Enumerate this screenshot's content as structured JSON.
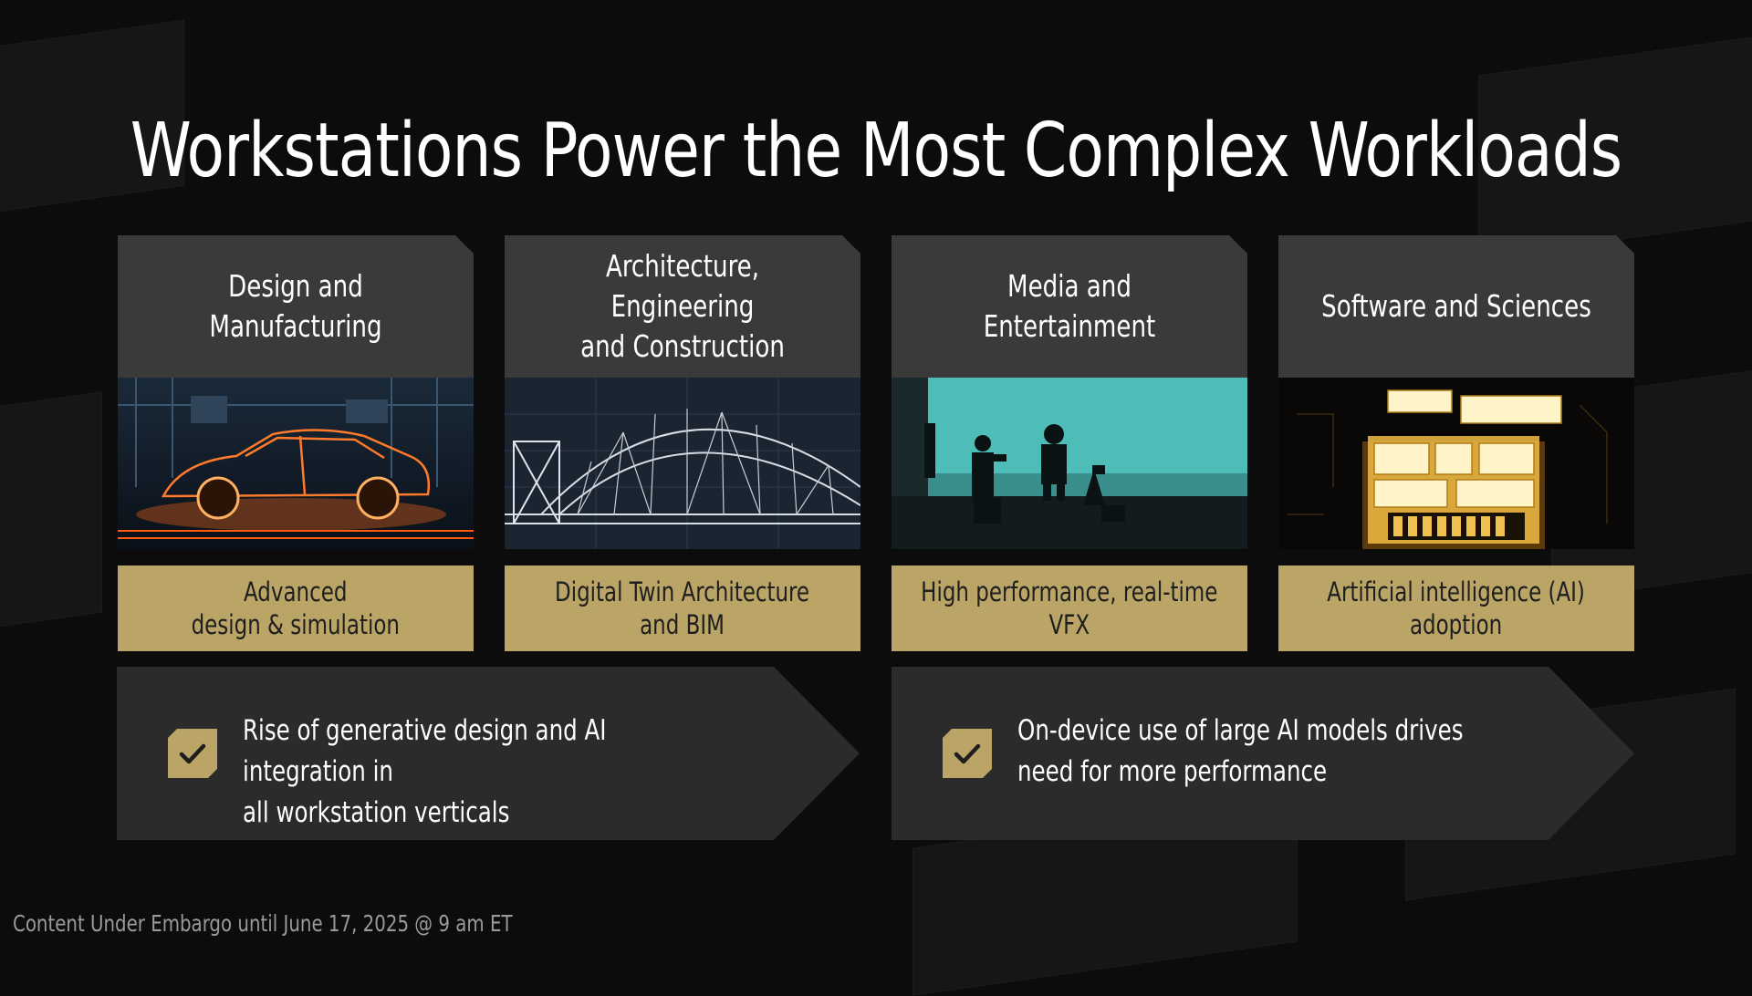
{
  "title": "Workstations Power the Most Complex Workloads",
  "cards": [
    {
      "heading": "Design and Manufacturing",
      "caption": "Advanced\ndesign & simulation",
      "image": "wireframe-car-image"
    },
    {
      "heading": "Architecture, Engineering\nand Construction",
      "caption": "Digital Twin Architecture\nand BIM",
      "image": "wireframe-bridge-image"
    },
    {
      "heading": "Media and Entertainment",
      "caption": "High performance, real-time\nVFX",
      "image": "film-set-image"
    },
    {
      "heading": "Software and Sciences",
      "caption": "Artificial intelligence (AI)\nadoption",
      "image": "glowing-chip-image"
    }
  ],
  "highlights": [
    {
      "text": "Rise of generative design and AI integration in\nall workstation verticals",
      "icon": "check-icon"
    },
    {
      "text": "On-device use of large AI models drives\nneed for more performance",
      "icon": "check-icon"
    }
  ],
  "footer": {
    "embargo": "Content Under Embargo until June 17, 2025 @ 9 am ET"
  },
  "colors": {
    "accent": "#baa566",
    "card": "#3a3a3a",
    "arrow": "#2b2b2b",
    "background": "#0c0c0c"
  }
}
